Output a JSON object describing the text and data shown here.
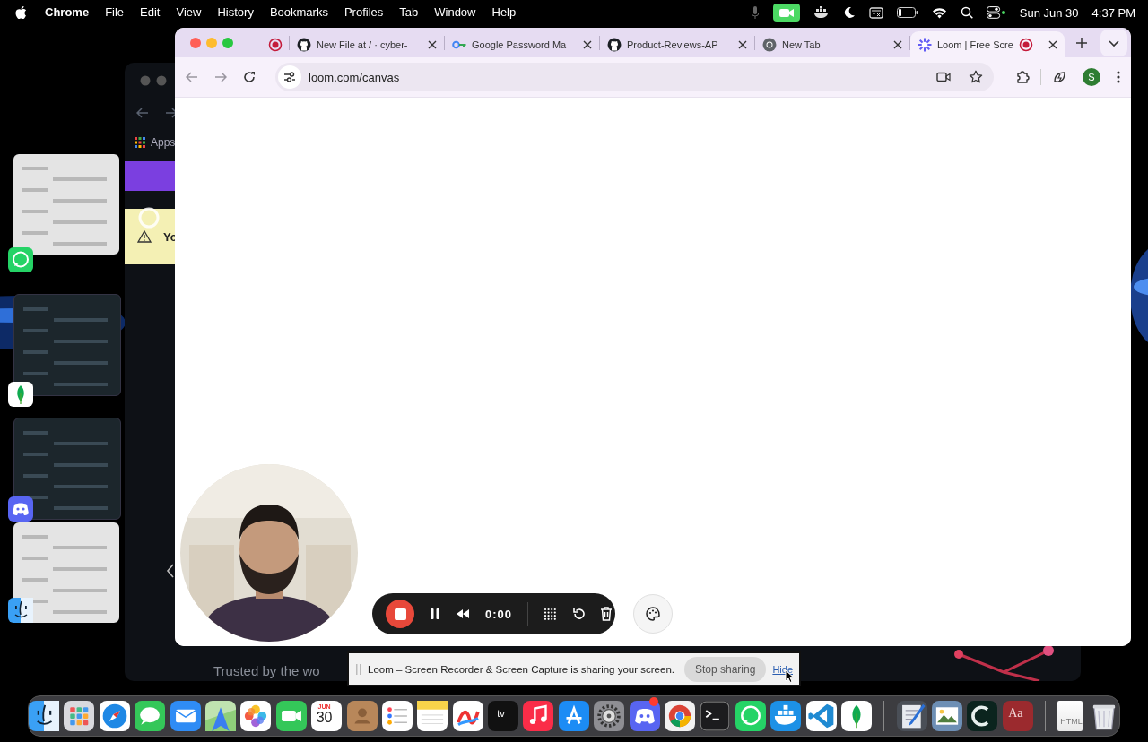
{
  "menu_bar": {
    "app": "Chrome",
    "menus": [
      "File",
      "Edit",
      "View",
      "History",
      "Bookmarks",
      "Profiles",
      "Tab",
      "Window",
      "Help"
    ],
    "camera_in_use": true,
    "date": "Sun Jun 30",
    "time": "4:37 PM"
  },
  "background_window": {
    "bookmark": "Apps",
    "banner": "Yo",
    "footer": "Trusted by the wo"
  },
  "browser": {
    "tabs": [
      {
        "kind": "pinned",
        "selected": false,
        "recording": true
      },
      {
        "kind": "normal",
        "title": "New File at / · cyber-",
        "selected": false,
        "recording": false
      },
      {
        "kind": "normal",
        "title": "Google Password Ma",
        "selected": false,
        "recording": false
      },
      {
        "kind": "normal",
        "title": "Product-Reviews-AP",
        "selected": false,
        "recording": false
      },
      {
        "kind": "normal",
        "title": "New Tab",
        "selected": false,
        "recording": false
      },
      {
        "kind": "normal",
        "title": "Loom | Free Scre",
        "selected": true,
        "recording": true
      }
    ],
    "url": "loom.com/canvas",
    "profile_initial": "S"
  },
  "loom": {
    "timer": "0:00",
    "sharing_bar": {
      "message": "Loom – Screen Recorder & Screen Capture is sharing your screen.",
      "stop": "Stop sharing",
      "hide": "Hide"
    }
  },
  "dock": {
    "apps": [
      {
        "kind": "finder"
      },
      {
        "kind": "launchpad"
      },
      {
        "kind": "safari"
      },
      {
        "kind": "messages"
      },
      {
        "kind": "mail"
      },
      {
        "kind": "maps"
      },
      {
        "kind": "photos"
      },
      {
        "kind": "facetime"
      },
      {
        "kind": "calendar",
        "month": "JUN",
        "day": "30"
      },
      {
        "kind": "contacts"
      },
      {
        "kind": "reminders"
      },
      {
        "kind": "notes"
      },
      {
        "kind": "freeform"
      },
      {
        "kind": "tv",
        "label": "tv"
      },
      {
        "kind": "music"
      },
      {
        "kind": "appstore"
      },
      {
        "kind": "settings"
      },
      {
        "kind": "discord",
        "notification": true
      },
      {
        "kind": "chrome"
      },
      {
        "kind": "terminal"
      },
      {
        "kind": "whatsapp"
      },
      {
        "kind": "docker"
      },
      {
        "kind": "vscode"
      },
      {
        "kind": "mongodb"
      },
      {
        "kind": "separator"
      },
      {
        "kind": "textedit"
      },
      {
        "kind": "preview"
      },
      {
        "kind": "cursor"
      },
      {
        "kind": "dictionary",
        "label": "Aa"
      },
      {
        "kind": "separator"
      },
      {
        "kind": "file",
        "label": "HTML"
      },
      {
        "kind": "trash"
      }
    ]
  }
}
